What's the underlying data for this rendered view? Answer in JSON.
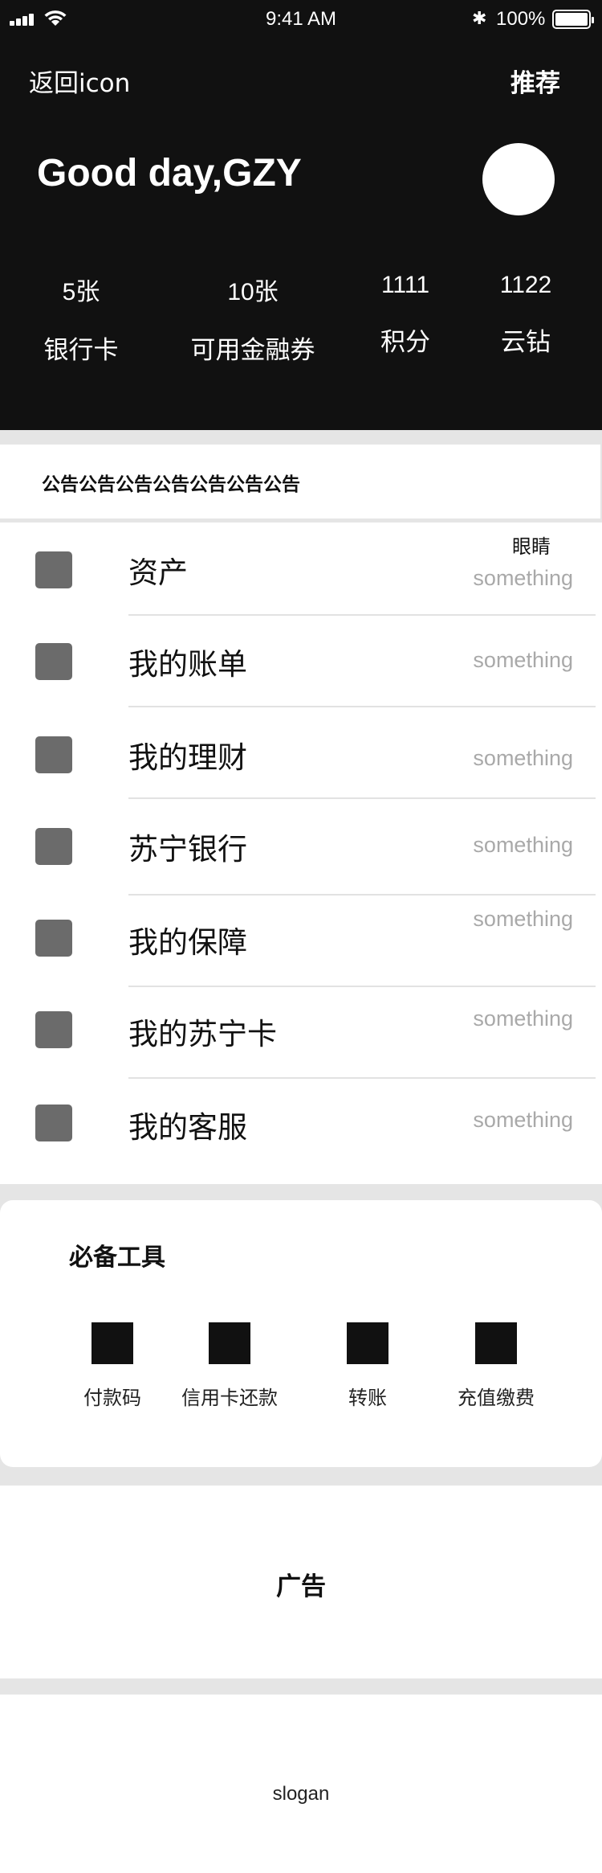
{
  "status_bar": {
    "time": "9:41 AM",
    "battery": "100%"
  },
  "header": {
    "back_label": "返回icon",
    "recommend_label": "推荐",
    "greeting": "Good day,GZY",
    "stats": [
      {
        "value": "5张",
        "label": "银行卡"
      },
      {
        "value": "10张",
        "label": "可用金融券"
      },
      {
        "value": "1111",
        "label": "积分"
      },
      {
        "value": "1122",
        "label": "云钻"
      }
    ]
  },
  "notice": {
    "text": "公告公告公告公告公告公告公告"
  },
  "menu": {
    "eye_label": "眼睛",
    "items": [
      {
        "label": "资产",
        "value": "something"
      },
      {
        "label": "我的账单",
        "value": "something"
      },
      {
        "label": "我的理财",
        "value": "something"
      },
      {
        "label": "苏宁银行",
        "value": "something"
      },
      {
        "label": "我的保障",
        "value": "something"
      },
      {
        "label": "我的苏宁卡",
        "value": "something"
      },
      {
        "label": "我的客服",
        "value": "something"
      }
    ]
  },
  "tools": {
    "title": "必备工具",
    "items": [
      {
        "label": "付款码"
      },
      {
        "label": "信用卡还款"
      },
      {
        "label": "转账"
      },
      {
        "label": "充值缴费"
      }
    ]
  },
  "ad": {
    "text": "广告"
  },
  "footer": {
    "slogan": "slogan"
  }
}
